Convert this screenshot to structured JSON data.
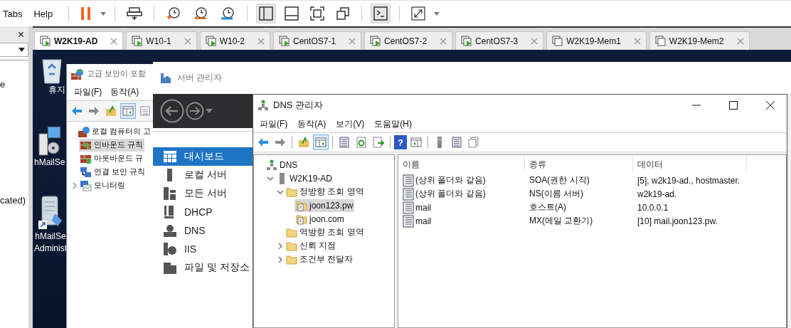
{
  "menu": [
    "Tabs",
    "Help"
  ],
  "toolbar": [
    {
      "kind": "pause",
      "on": false
    },
    {
      "kind": "send-keys",
      "on": false
    },
    {
      "kind": "snapshot-take",
      "on": false
    },
    {
      "kind": "snapshot-revert",
      "on": false
    },
    {
      "kind": "snapshot-manage",
      "on": false
    },
    {
      "kind": "library",
      "on": true
    },
    {
      "kind": "thumbnail",
      "on": false
    },
    {
      "kind": "fullscreen",
      "on": false
    },
    {
      "kind": "unity",
      "on": false
    },
    {
      "kind": "console",
      "on": true
    },
    {
      "kind": "stretch",
      "on": false
    }
  ],
  "library_panel": {
    "close": "×",
    "items": [
      "e",
      "cated)"
    ]
  },
  "tabs": [
    {
      "label": "W2K19-AD",
      "selected": true,
      "running": true
    },
    {
      "label": "W10-1",
      "selected": false,
      "running": true
    },
    {
      "label": "W10-2",
      "selected": false,
      "running": true
    },
    {
      "label": "CentOS7-1",
      "selected": false,
      "running": true
    },
    {
      "label": "CentOS7-2",
      "selected": false,
      "running": true
    },
    {
      "label": "CentOS7-3",
      "selected": false,
      "running": true
    },
    {
      "label": "W2K19-Mem1",
      "selected": false,
      "running": false
    },
    {
      "label": "W2K19-Mem2",
      "selected": false,
      "running": false
    }
  ],
  "desktop_icons": [
    {
      "kind": "recycle-bin",
      "lines": [
        "휴지"
      ]
    },
    {
      "kind": "server-setup",
      "lines": [
        "hMailSe"
      ]
    },
    {
      "kind": "admin-shortcut",
      "lines": [
        "hMailSe",
        "Administ"
      ]
    }
  ],
  "firewall_window": {
    "title": "고급 보안이 포함",
    "menu": [
      "파일(F)",
      "동작(A)"
    ],
    "toolbar": [
      {
        "kind": "back",
        "on": false
      },
      {
        "kind": "forward",
        "on": false
      },
      {
        "kind": "up",
        "on": false
      },
      {
        "kind": "tree-toggle",
        "on": true
      },
      {
        "kind": "list",
        "on": false
      }
    ],
    "tree": [
      {
        "label": "로컬 컴퓨터의 고",
        "kind": "firewall",
        "selected": false,
        "children": [
          {
            "label": "인바운드 규칙",
            "kind": "inbound",
            "selected": true
          },
          {
            "label": "아웃바운드 규",
            "kind": "outbound",
            "selected": false
          },
          {
            "label": "연결 보안 규칙",
            "kind": "connection",
            "selected": false
          },
          {
            "label": "모니터링",
            "kind": "monitor",
            "selected": false,
            "expanded": false
          }
        ]
      }
    ]
  },
  "server_manager": {
    "title": "서버 관리자",
    "sidebar": [
      {
        "label": "대시보드",
        "kind": "dashboard",
        "selected": true
      },
      {
        "label": "로컬 서버",
        "kind": "local",
        "selected": false
      },
      {
        "label": "모든 서버",
        "kind": "all",
        "selected": false
      },
      {
        "label": "DHCP",
        "kind": "dhcp",
        "selected": false
      },
      {
        "label": "DNS",
        "kind": "dns",
        "selected": false
      },
      {
        "label": "IIS",
        "kind": "iis",
        "selected": false
      },
      {
        "label": "파일 및 저장소",
        "kind": "files",
        "selected": false
      }
    ]
  },
  "dns_window": {
    "title": "DNS 관리자",
    "menu": [
      "파일(F)",
      "동작(A)",
      "보기(V)",
      "도움말(H)"
    ],
    "toolbar": [
      {
        "kind": "back",
        "on": false
      },
      {
        "kind": "forward",
        "on": false
      },
      {
        "kind": "sep"
      },
      {
        "kind": "up",
        "on": false
      },
      {
        "kind": "tree-toggle",
        "on": true
      },
      {
        "kind": "sep"
      },
      {
        "kind": "properties",
        "on": false
      },
      {
        "kind": "refresh",
        "on": false
      },
      {
        "kind": "export",
        "on": false
      },
      {
        "kind": "sep"
      },
      {
        "kind": "help",
        "glyph": "?",
        "on": false
      },
      {
        "kind": "panel",
        "on": false
      },
      {
        "kind": "sep"
      },
      {
        "kind": "server",
        "on": false
      },
      {
        "kind": "records",
        "on": false
      },
      {
        "kind": "copy",
        "on": false
      }
    ],
    "tree": [
      {
        "label": "DNS",
        "kind": "dns",
        "selected": false,
        "children": [
          {
            "label": "W2K19-AD",
            "kind": "server",
            "selected": false,
            "expanded": true,
            "children": [
              {
                "label": "정방향 조회 영역",
                "kind": "folder",
                "selected": false,
                "expanded": true,
                "children": [
                  {
                    "label": "joon123.pw",
                    "kind": "zone",
                    "selected": true
                  },
                  {
                    "label": "joon.com",
                    "kind": "zone",
                    "selected": false
                  }
                ]
              },
              {
                "label": "역방향 조회 영역",
                "kind": "folder",
                "selected": false
              },
              {
                "label": "신뢰 지점",
                "kind": "folder",
                "selected": false,
                "expanded": false
              },
              {
                "label": "조건부 전달자",
                "kind": "folder",
                "selected": false,
                "expanded": false
              }
            ]
          }
        ]
      }
    ],
    "columns": [
      "이름",
      "종류",
      "데이터"
    ],
    "rows": [
      {
        "name": "(상위 폴더와 같음)",
        "type": "SOA(권한 시작)",
        "data": "[5], w2k19-ad., hostmaster."
      },
      {
        "name": "(상위 폴더와 같음)",
        "type": "NS(이름 서버)",
        "data": "w2k19-ad."
      },
      {
        "name": "mail",
        "type": "호스트(A)",
        "data": "10.0.0.1"
      },
      {
        "name": "mail",
        "type": "MX(메일 교환기)",
        "data": "[10]  mail.joon123.pw."
      }
    ]
  }
}
